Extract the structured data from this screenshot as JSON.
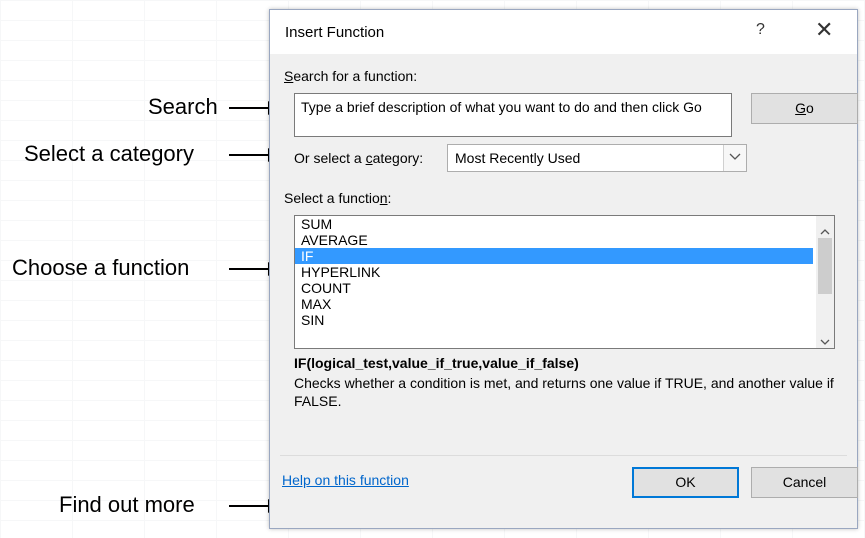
{
  "annotations": {
    "search": "Search",
    "category": "Select a category",
    "choose": "Choose a function",
    "more": "Find out more"
  },
  "dialog": {
    "title": "Insert Function",
    "help_glyph": "?",
    "close_glyph": "✕",
    "search_label": "earch for a function:",
    "search_label_key": "S",
    "search_text": "Type a brief description of what you want to do and then click Go",
    "go_label_key": "G",
    "go_label_rest": "o",
    "category_label_pre": "Or select a ",
    "category_label_key": "c",
    "category_label_post": "ategory:",
    "category_value": "Most Recently Used",
    "function_label_pre": "Select a functio",
    "function_label_key": "n",
    "function_label_post": ":",
    "functions": [
      "SUM",
      "AVERAGE",
      "IF",
      "HYPERLINK",
      "COUNT",
      "MAX",
      "SIN"
    ],
    "selected_function": "IF",
    "syntax": "IF(logical_test,value_if_true,value_if_false)",
    "description": "Checks whether a condition is met, and returns one value if TRUE, and another value if FALSE.",
    "help_link": "Help on this function",
    "ok_label": "OK",
    "cancel_label": "Cancel"
  },
  "colors": {
    "selection": "#3399ff",
    "link": "#0066cc",
    "focus_border": "#0078d7"
  }
}
